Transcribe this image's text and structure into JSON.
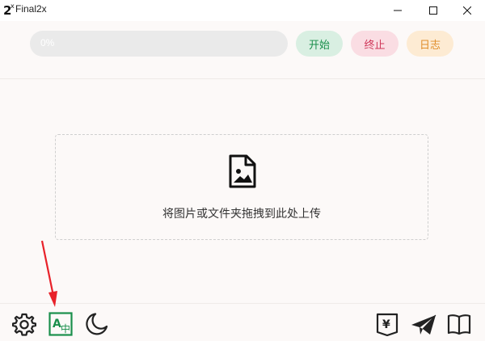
{
  "window": {
    "title": "Final2x",
    "logo_text": "2",
    "logo_sup": "x"
  },
  "toolbar": {
    "progress_text": "0%",
    "progress_value": 0,
    "start_label": "开始",
    "stop_label": "终止",
    "log_label": "日志"
  },
  "dropzone": {
    "text": "将图片或文件夹拖拽到此处上传"
  },
  "bottom": {
    "left_icons": [
      "gear-icon",
      "translate-icon",
      "moon-icon"
    ],
    "right_icons": [
      "yen-donate-icon",
      "paper-plane-icon",
      "book-icon"
    ],
    "translate_glyph_a": "A",
    "translate_glyph_b": "中",
    "yen_glyph": "¥"
  },
  "colors": {
    "accent_green": "#1a8f4c",
    "start_bg": "#d9efe2",
    "stop_fg": "#d0385a",
    "stop_bg": "#fadde3",
    "log_fg": "#e08e2b",
    "log_bg": "#fdebd3",
    "annotation_arrow": "#e8222a"
  }
}
